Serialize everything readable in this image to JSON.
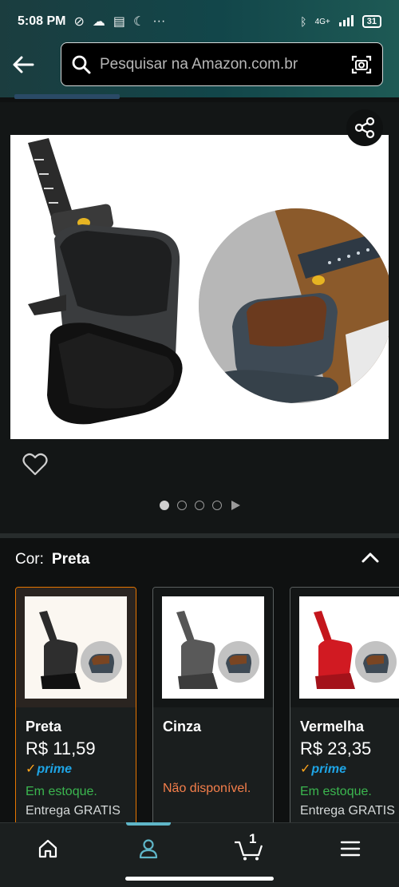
{
  "status_bar": {
    "time": "5:08 PM",
    "network": "4G+",
    "battery": "31"
  },
  "search": {
    "placeholder": "Pesquisar na Amazon.com.br"
  },
  "gallery": {
    "image_count": 4,
    "active_index": 0
  },
  "color_selector": {
    "label": "Cor:",
    "selected": "Preta"
  },
  "variants": [
    {
      "name": "Preta",
      "price": "R$ 11,59",
      "prime": "prime",
      "availability": "Em estoque.",
      "shipping": "Entrega GRATIS",
      "selected": true
    },
    {
      "name": "Cinza",
      "availability": "Não disponível.",
      "selected": false
    },
    {
      "name": "Vermelha",
      "price": "R$ 23,35",
      "prime": "prime",
      "availability": "Em estoque.",
      "shipping": "Entrega GRATIS",
      "selected": false
    }
  ],
  "bottom_nav": {
    "cart_count": "1",
    "active": "account"
  },
  "colors": {
    "accent_orange": "#e77600",
    "in_stock_green": "#3bb64f",
    "unavailable_orange": "#f57f4b",
    "prime_blue": "#1ea5e6",
    "nav_indicator": "#5fb6c8"
  }
}
